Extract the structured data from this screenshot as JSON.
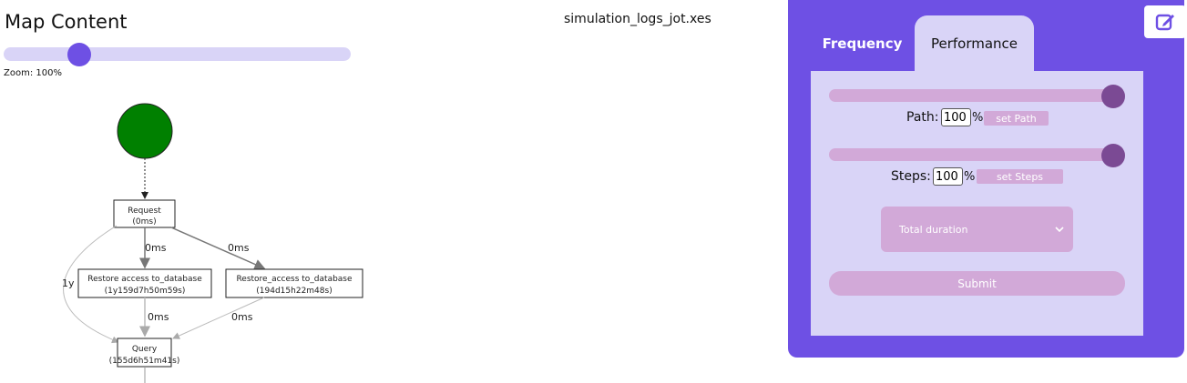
{
  "map": {
    "title": "Map Content",
    "zoom_label": "Zoom: 100%",
    "zoom_percent": 100,
    "file_name": "simulation_logs_jot.xes"
  },
  "graph": {
    "nodes": {
      "start": {
        "color": "#008000"
      },
      "request": {
        "label": "Request",
        "sub": "(0ms)"
      },
      "restore_left": {
        "label": "Restore access to_database",
        "sub": "(1y159d7h50m59s)"
      },
      "restore_right": {
        "label": "Restore_access to_database",
        "sub": "(194d15h22m48s)"
      },
      "query": {
        "label": "Query",
        "sub": "(155d6h51m41s)"
      }
    },
    "edges": {
      "req_to_restore_left": "0ms",
      "req_to_restore_right": "0ms",
      "req_to_query": "1y",
      "restore_left_to_query": "0ms",
      "restore_right_to_query": "0ms"
    }
  },
  "panel": {
    "tabs": {
      "frequency": "Frequency",
      "performance": "Performance"
    },
    "path": {
      "label": "Path:",
      "value": "100",
      "unit": "%",
      "button": "set Path",
      "slider_percent": 100
    },
    "steps": {
      "label": "Steps:",
      "value": "100",
      "unit": "%",
      "button": "set Steps",
      "slider_percent": 100
    },
    "select": {
      "selected": "Total duration"
    },
    "submit": "Submit"
  },
  "icons": {
    "edit": "edit-icon",
    "select_chevron": "chevron-down-icon"
  }
}
